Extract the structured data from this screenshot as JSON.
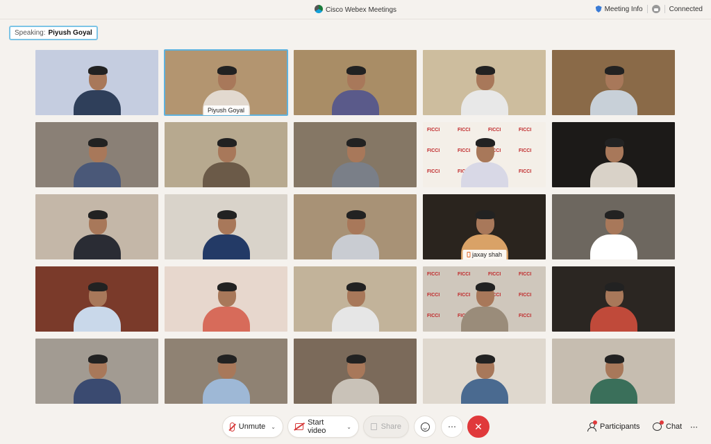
{
  "window": {
    "app_title": "Cisco Webex Meetings",
    "meeting_info_label": "Meeting Info",
    "status": "Connected"
  },
  "speaking": {
    "label": "Speaking:",
    "name": "Piyush Goyal"
  },
  "tiles": [
    {
      "bg": "#c5cde0",
      "shirt": "#2f3f5a",
      "name": ""
    },
    {
      "bg": "#b39570",
      "shirt": "#e2d9cf",
      "name": "Piyush Goyal",
      "active": true
    },
    {
      "bg": "#a98d66",
      "shirt": "#5a5a8a",
      "name": ""
    },
    {
      "bg": "#cdbd9e",
      "shirt": "#e8e8e8",
      "name": ""
    },
    {
      "bg": "#8a6a48",
      "shirt": "#c8d0d8",
      "name": ""
    },
    {
      "bg": "#8a8076",
      "shirt": "#4a5878",
      "name": ""
    },
    {
      "bg": "#b7a98f",
      "shirt": "#6b5a48",
      "name": ""
    },
    {
      "bg": "#857765",
      "shirt": "#7a7f88",
      "name": ""
    },
    {
      "bg": "#f4efe8",
      "shirt": "#d8d8e6",
      "name": "",
      "brand": "FICCI"
    },
    {
      "bg": "#1c1a18",
      "shirt": "#d9d2c8",
      "name": ""
    },
    {
      "bg": "#c4b7a8",
      "shirt": "#2a2c34",
      "name": ""
    },
    {
      "bg": "#d9d3ca",
      "shirt": "#233a66",
      "name": ""
    },
    {
      "bg": "#a89276",
      "shirt": "#c9ccd2",
      "name": ""
    },
    {
      "bg": "#2a241e",
      "shirt": "#d9a267",
      "name": "jaxay shah",
      "phone": true
    },
    {
      "bg": "#6d675f",
      "shirt": "#ffffff",
      "name": ""
    },
    {
      "bg": "#7a3a2a",
      "shirt": "#c9d8ea",
      "name": ""
    },
    {
      "bg": "#e7d7cd",
      "shirt": "#d76b5a",
      "name": ""
    },
    {
      "bg": "#c2b39a",
      "shirt": "#e6e6e6",
      "name": ""
    },
    {
      "bg": "#cfc7bc",
      "shirt": "#9a8c7a",
      "name": "",
      "brand": "FICCI"
    },
    {
      "bg": "#2b2622",
      "shirt": "#c04a3a",
      "name": ""
    },
    {
      "bg": "#a29b92",
      "shirt": "#3a4a70",
      "name": ""
    },
    {
      "bg": "#8f8273",
      "shirt": "#9eb8d6",
      "name": ""
    },
    {
      "bg": "#7b6a5a",
      "shirt": "#c9c2b8",
      "name": ""
    },
    {
      "bg": "#dfd8ce",
      "shirt": "#4a6a90",
      "name": ""
    },
    {
      "bg": "#c6bdb0",
      "shirt": "#3a6f5a",
      "name": ""
    }
  ],
  "toolbar": {
    "unmute_label": "Unmute",
    "start_video_label": "Start video",
    "share_label": "Share",
    "more_label": "⋯",
    "end_label": "✕",
    "participants_label": "Participants",
    "chat_label": "Chat",
    "overflow_label": "⋯"
  }
}
